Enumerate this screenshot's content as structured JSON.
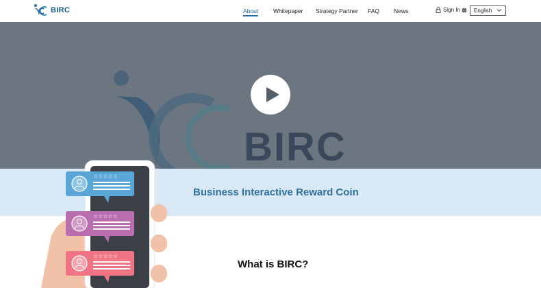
{
  "header": {
    "brand": "BIRC",
    "nav": [
      {
        "label": "About",
        "active": true
      },
      {
        "label": "Whitepaper",
        "active": false
      },
      {
        "label": "Strategy Partner",
        "active": false
      },
      {
        "label": "FAQ",
        "active": false
      },
      {
        "label": "News",
        "active": false
      }
    ],
    "sign_in": "Sign In",
    "language": "English"
  },
  "hero": {
    "logo_text": "BIRC",
    "play_icon": "play-icon"
  },
  "tagline": "Business Interactive Reward Coin",
  "section": {
    "title": "What is BIRC?"
  },
  "colors": {
    "accent": "#1e6aa3",
    "hero_bg": "#6b7680",
    "band_bg": "#d8e8f4",
    "tagline": "#2e6f9c"
  }
}
